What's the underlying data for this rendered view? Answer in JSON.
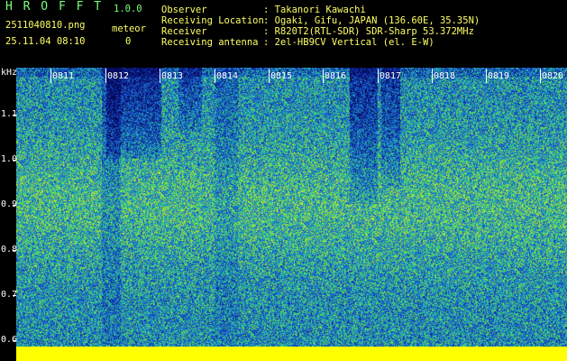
{
  "app": {
    "name": "H R O F F T",
    "version": "1.0.0",
    "filename": "2511040810.png",
    "datetime": "25.11.04 08:10",
    "meteor_label": "meteor",
    "meteor_count": "0"
  },
  "info": {
    "labels": [
      "Observer",
      "Receiving Location",
      "Receiver",
      "Receiving antenna"
    ],
    "values": [
      ": Takanori Kawachi",
      ": Ogaki, Gifu, JAPAN (136.60E, 35.35N)",
      ": R820T2(RTL-SDR) SDR-Sharp 53.372MHz",
      ": 2el-HB9CV Vertical (el. E-W)"
    ]
  },
  "spectrogram": {
    "y_unit": "kHz",
    "y_ticks": [
      "1.1",
      "1.0",
      "0.9",
      "0.8",
      "0.7",
      "0.6"
    ],
    "x_ticks": [
      "0811",
      "0812",
      "0813",
      "0814",
      "0815",
      "0816",
      "0817",
      "0818",
      "0819",
      "0820"
    ]
  },
  "colors": {
    "title_yellow": "#ffff66",
    "text_white": "#ffffff",
    "text_green": "#7dff7d",
    "noise_floor": "#ffff00"
  }
}
